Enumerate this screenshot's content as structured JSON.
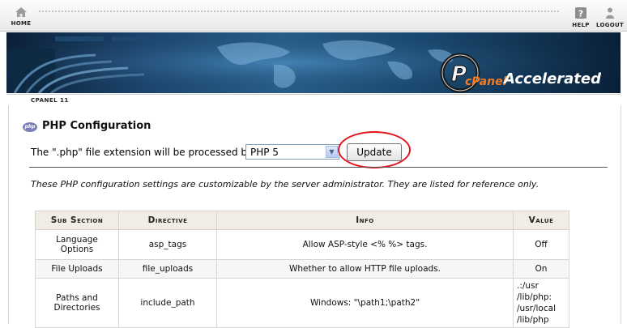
{
  "topbar": {
    "home_label": "HOME",
    "help_label": "HELP",
    "logout_label": "LOGOUT"
  },
  "banner": {
    "logo_text": "cPanel Accelerated",
    "logo_small": "cPanel",
    "logo_big": "Accelerated"
  },
  "breadcrumb": "CPANEL 11",
  "page": {
    "title": "PHP Configuration",
    "icon_text": "php",
    "processor_label": "The \".php\" file extension will be processed by",
    "php_version_selected": "PHP 5",
    "update_label": "Update",
    "note": "These PHP configuration settings are customizable by the server administrator. They are listed for reference only."
  },
  "table": {
    "headers": [
      "Sub Section",
      "Directive",
      "Info",
      "Value"
    ],
    "rows": [
      {
        "sub": "Language Options",
        "directive": "asp_tags",
        "info": "Allow ASP-style <% %> tags.",
        "value": "Off"
      },
      {
        "sub": "File Uploads",
        "directive": "file_uploads",
        "info": "Whether to allow HTTP file uploads.",
        "value": "On"
      },
      {
        "sub": "Paths and Directories",
        "directive": "include_path",
        "info": "Windows: \"\\path1;\\path2\"",
        "value": ".:/usr /lib/php: /usr/local /lib/php"
      }
    ]
  },
  "colors": {
    "annotation_circle": "#e3141c",
    "table_header_bg": "#f1ece4"
  }
}
